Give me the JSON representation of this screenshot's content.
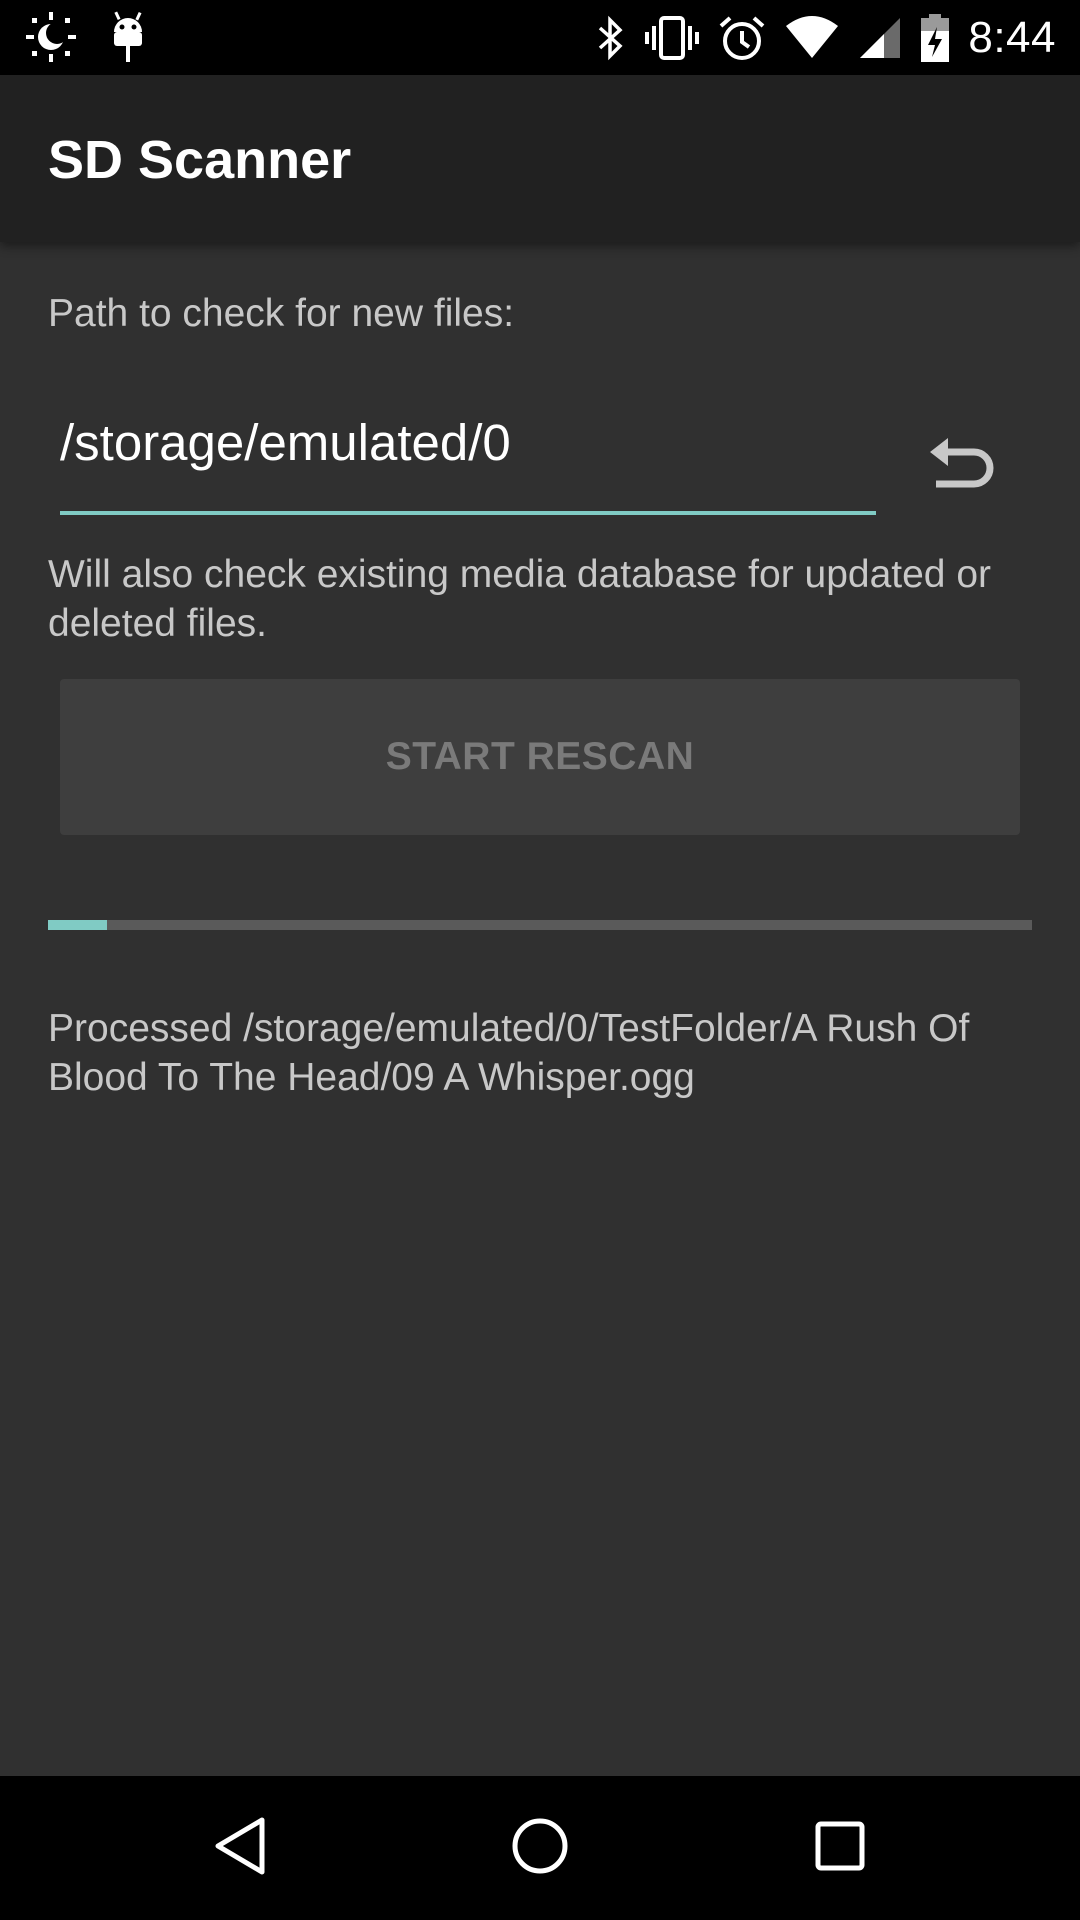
{
  "status_bar": {
    "time": "8:44",
    "left_icons": [
      "brightness-icon",
      "android-debug-icon"
    ],
    "right_icons": [
      "bluetooth-icon",
      "vibrate-icon",
      "alarm-icon",
      "wifi-icon",
      "cell-signal-icon",
      "battery-charging-icon"
    ]
  },
  "app_bar": {
    "title": "SD Scanner"
  },
  "main": {
    "path_label": "Path to check for new files:",
    "path_value": "/storage/emulated/0",
    "note": "Will also check existing media database for updated or deleted files.",
    "start_button_label": "START RESCAN",
    "progress_fraction": 0.06,
    "processed_text": "Processed /storage/emulated/0/TestFolder/A Rush Of Blood To The Head/09 A Whisper.ogg"
  },
  "nav_bar": {
    "icons": [
      "back-icon",
      "home-icon",
      "recents-icon"
    ]
  },
  "colors": {
    "accent": "#80cbc4",
    "background": "#303030",
    "app_bar": "#212121",
    "button_bg": "#3e3e3e"
  }
}
